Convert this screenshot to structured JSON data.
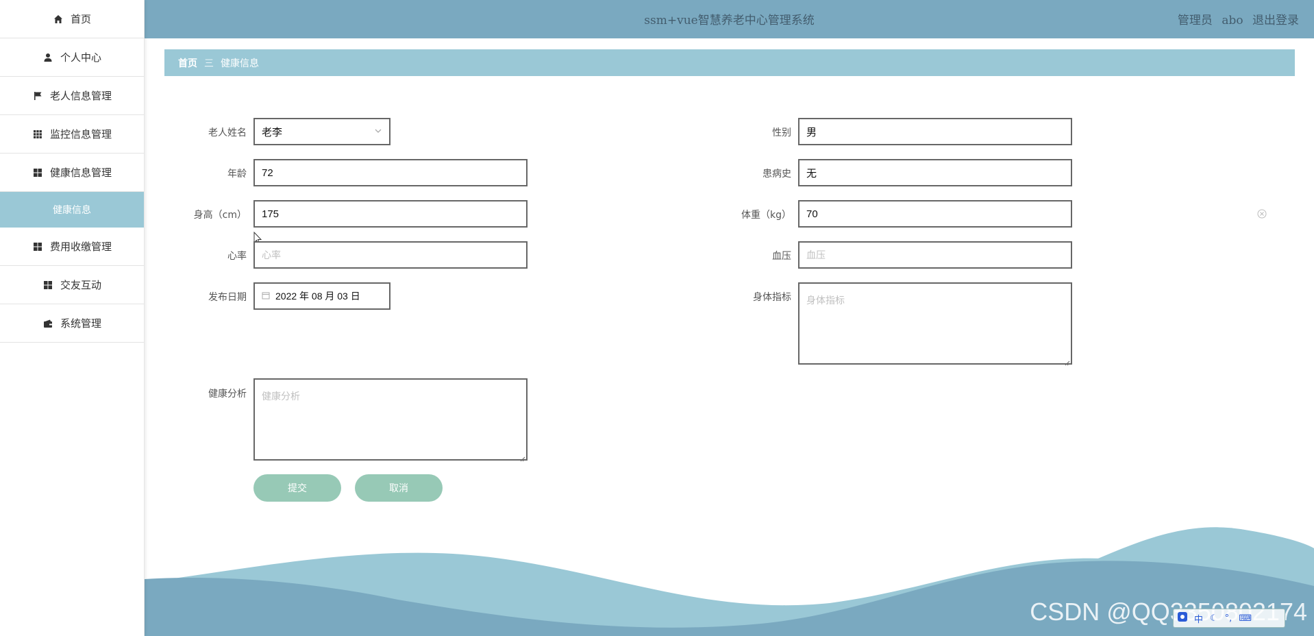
{
  "sidebar": {
    "items": [
      {
        "label": "首页",
        "icon": "home-icon"
      },
      {
        "label": "个人中心",
        "icon": "user-icon"
      },
      {
        "label": "老人信息管理",
        "icon": "flag-icon"
      },
      {
        "label": "监控信息管理",
        "icon": "grid-icon"
      },
      {
        "label": "健康信息管理",
        "icon": "grid4-icon"
      }
    ],
    "active_sub": "健康信息",
    "items_after": [
      {
        "label": "费用收缴管理",
        "icon": "grid4-icon"
      },
      {
        "label": "交友互动",
        "icon": "grid4-icon"
      },
      {
        "label": "系统管理",
        "icon": "wallet-icon"
      }
    ]
  },
  "header": {
    "title": "ssm+vue智慧养老中心管理系统",
    "role": "管理员",
    "username": "abo",
    "logout": "退出登录"
  },
  "breadcrumb": {
    "home": "首页",
    "separator": "三",
    "current": "健康信息"
  },
  "form": {
    "elder_name": {
      "label": "老人姓名",
      "value": "老李"
    },
    "gender": {
      "label": "性别",
      "value": "男"
    },
    "age": {
      "label": "年龄",
      "value": "72"
    },
    "history": {
      "label": "患病史",
      "value": "无"
    },
    "height": {
      "label": "身高（cm）",
      "value": "175"
    },
    "weight": {
      "label": "体重（kg）",
      "value": "70"
    },
    "heart_rate": {
      "label": "心率",
      "placeholder": "心率"
    },
    "blood_pressure": {
      "label": "血压",
      "placeholder": "血压"
    },
    "date": {
      "label": "发布日期",
      "value": "2022 年 08 月 03 日"
    },
    "body_index": {
      "label": "身体指标",
      "placeholder": "身体指标"
    },
    "analysis": {
      "label": "健康分析",
      "placeholder": "健康分析"
    }
  },
  "buttons": {
    "submit": "提交",
    "cancel": "取消"
  },
  "watermark": "CSDN @QQ3350802174",
  "ime": "中"
}
